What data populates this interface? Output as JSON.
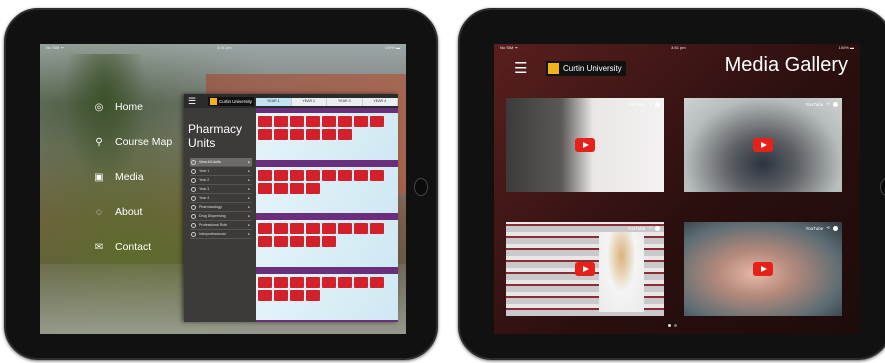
{
  "left_screen": {
    "status": {
      "carrier": "No SIM ᯤ",
      "time": "3:51 pm",
      "battery": "100% ▬"
    },
    "menu": [
      {
        "label": "Home",
        "icon": "home-icon",
        "glyph": "◎"
      },
      {
        "label": "Course Map",
        "icon": "location-pin-icon",
        "glyph": "⚲"
      },
      {
        "label": "Media",
        "icon": "video-icon",
        "glyph": "▣"
      },
      {
        "label": "About",
        "icon": "speech-bubble-icon",
        "glyph": "◌"
      },
      {
        "label": "Contact",
        "icon": "envelope-icon",
        "glyph": "✉"
      }
    ],
    "panel": {
      "hamburger": "☰",
      "logo_text": "Curtin University",
      "title_line1": "Pharmacy",
      "title_line2": "Units",
      "list": [
        {
          "label": "View All Units",
          "active": true
        },
        {
          "label": "Year 1",
          "active": false
        },
        {
          "label": "Year 2",
          "active": false
        },
        {
          "label": "Year 3",
          "active": false
        },
        {
          "label": "Year 4",
          "active": false
        },
        {
          "label": "Pharmacology",
          "active": false
        },
        {
          "label": "Drug Dispensing",
          "active": false
        },
        {
          "label": "Professional Role",
          "active": false
        },
        {
          "label": "Interprofessional",
          "active": false
        }
      ],
      "years": [
        "YEAR 1",
        "YEAR 2",
        "YEAR 3",
        "YEAR 4"
      ]
    }
  },
  "right_screen": {
    "status": {
      "carrier": "No SIM ᯤ",
      "time": "3:51 pm",
      "battery": "100% ▬"
    },
    "hamburger": "☰",
    "logo_text": "Curtin University",
    "title": "Media Gallery",
    "video_badge": "YouTube",
    "videos": [
      {
        "name": "video-thumbnail-1"
      },
      {
        "name": "video-thumbnail-2"
      },
      {
        "name": "video-thumbnail-3"
      },
      {
        "name": "video-thumbnail-4"
      }
    ],
    "pages": 2,
    "current_page": 1
  },
  "colors": {
    "accent_red": "#d3212c",
    "youtube_red": "#e62117",
    "logo_gold": "#f2b21b",
    "panel_purple": "#6a2f7c"
  }
}
